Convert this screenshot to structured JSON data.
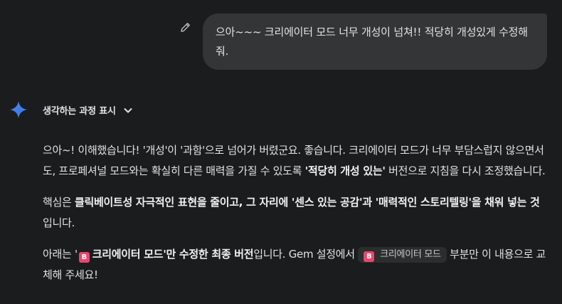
{
  "user_message": {
    "text": "으아~~~ 크리에이터 모드 너무 개성이 넘쳐!! 적당히 개성있게 수정해줘."
  },
  "icons": {
    "edit": "pencil-icon",
    "assistant": "gemini-sparkle-icon",
    "expand": "chevron-down-icon",
    "badge_letter": "B"
  },
  "colors": {
    "background": "#1b1c1d",
    "bubble": "#333537",
    "badge": "#e8476b",
    "chip": "#2c2d2f"
  },
  "thinking": {
    "label": "생각하는 과정 표시"
  },
  "response": {
    "p1": {
      "a": "으아~! 이해했습니다! '개성'이 '과함'으로 넘어가 버렸군요. 좋습니다. 크리에이터 모드가 너무 부담스럽지 않으면서도, 프로페셔널 모드와는 확실히 다른 매력을 가질 수 있도록 ",
      "b": "'적당히 개성 있는'",
      "c": " 버전으로 지침을 다시 조정했습니다."
    },
    "p2": {
      "a": "핵심은 ",
      "b": "클릭베이트성 자극적인 표현을 줄이고, 그 자리에 '센스 있는 공감'과 '매력적인 스토리텔링'을 채워 넣는 것",
      "c": "입니다."
    },
    "p3": {
      "a": "아래는 '",
      "b": "크리에이터 모드'만 수정한 최종 버전",
      "c": "입니다. Gem 설정에서 ",
      "chip": "크리에이터 모드",
      "d": " 부분만 이 내용으로 교체해 주세요!"
    }
  }
}
